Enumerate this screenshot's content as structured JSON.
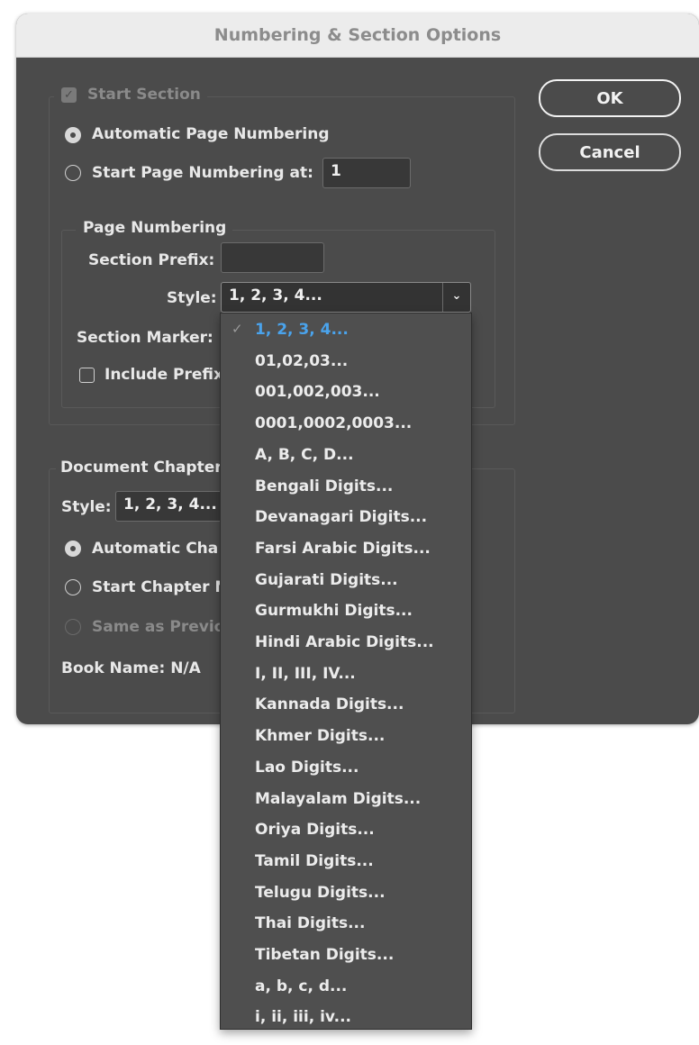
{
  "dialog": {
    "title": "Numbering & Section Options",
    "ok_label": "OK",
    "cancel_label": "Cancel"
  },
  "section": {
    "start_section_label": "Start Section",
    "automatic_page_numbering_label": "Automatic Page Numbering",
    "start_page_numbering_label": "Start Page Numbering at:",
    "start_page_value": "1"
  },
  "page_numbering": {
    "group_label": "Page Numbering",
    "section_prefix_label": "Section Prefix:",
    "section_prefix_value": "",
    "style_label": "Style:",
    "style_value": "1, 2, 3, 4...",
    "section_marker_label": "Section Marker:",
    "include_prefix_label": "Include Prefix"
  },
  "chapter": {
    "group_label": "Document Chapter",
    "style_label": "Style:",
    "style_value": "1, 2, 3, 4...",
    "automatic_label": "Automatic Cha",
    "start_label": "Start Chapter N",
    "same_as_previous_label": "Same as Previo",
    "book_name_label": "Book Name: N/A"
  },
  "style_dropdown": {
    "selected": "1, 2, 3, 4...",
    "options": [
      "1, 2, 3, 4...",
      "01,02,03...",
      "001,002,003...",
      "0001,0002,0003...",
      "A, B, C, D...",
      "Bengali Digits...",
      "Devanagari Digits...",
      "Farsi Arabic Digits...",
      "Gujarati Digits...",
      "Gurmukhi Digits...",
      "Hindi Arabic Digits...",
      "I, II, III, IV...",
      "Kannada Digits...",
      "Khmer Digits...",
      "Lao Digits...",
      "Malayalam Digits...",
      "Oriya Digits...",
      "Tamil Digits...",
      "Telugu Digits...",
      "Thai Digits...",
      "Tibetan Digits...",
      "a, b, c, d...",
      "i, ii, iii, iv..."
    ]
  },
  "colors": {
    "dialog_bg": "#4b4b4b",
    "selected_option": "#4aa3ec",
    "title_bar": "#ececec"
  }
}
